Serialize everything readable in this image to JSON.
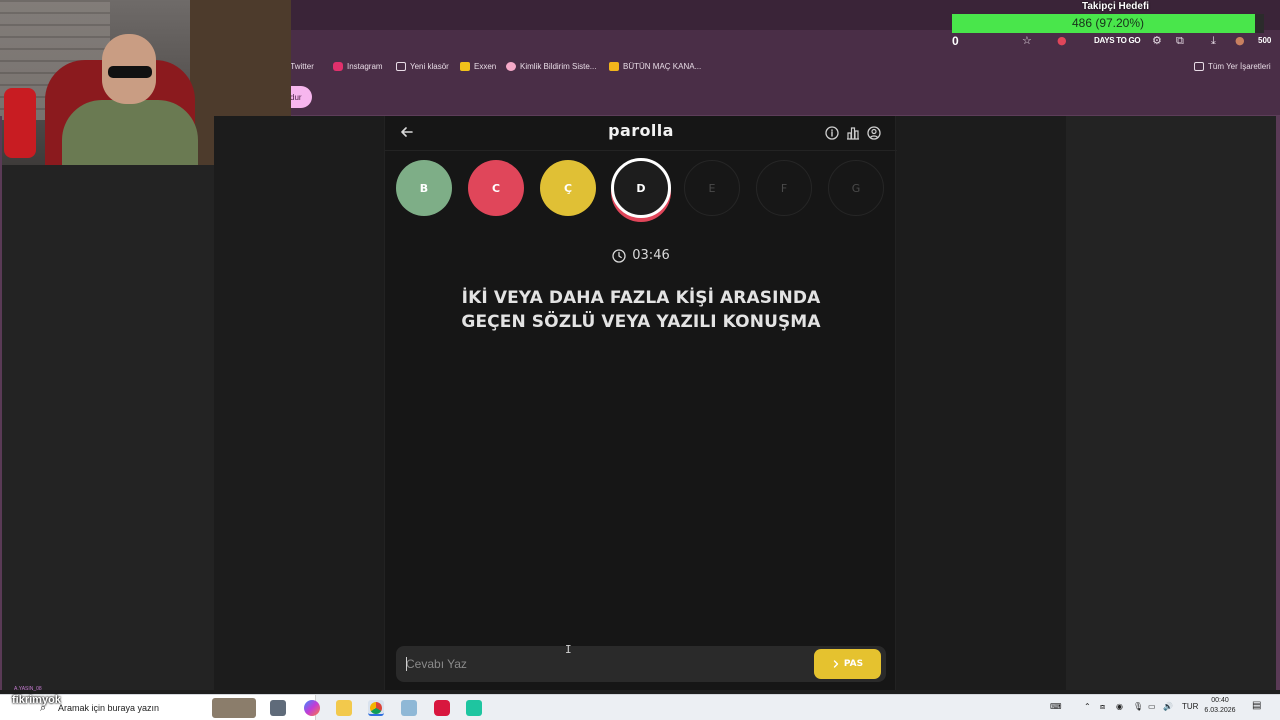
{
  "browser": {
    "bookmarks": [
      {
        "label": "/ Twitter",
        "icon": "twitter-icon"
      },
      {
        "label": "Instagram",
        "icon": "instagram-icon"
      },
      {
        "label": "Yeni klasör",
        "icon": "folder-icon"
      },
      {
        "label": "Exxen",
        "icon": "exxen-icon"
      },
      {
        "label": "Kimlik Bildirim Siste...",
        "icon": "link-icon"
      },
      {
        "label": "BÜTÜN MAÇ KANA...",
        "icon": "jp-icon"
      }
    ],
    "all_bookmarks": "Tüm Yer İşaretleri",
    "pill_text": "dur"
  },
  "stream_overlay": {
    "goal_title": "Takipçi Hedefi",
    "goal_text": "486 (97.20%)",
    "goal_fraction": 0.972,
    "left_counter": "0",
    "days_to_go": "DAYS TO GO",
    "right_counter": "500",
    "watermark": "fikrimyok",
    "tiny_name": "A.YASIN_08"
  },
  "game": {
    "title": "parolla",
    "letters": [
      {
        "letter": "B",
        "state": "correct",
        "color": "#7eae87"
      },
      {
        "letter": "C",
        "state": "wrong",
        "color": "#e0465a"
      },
      {
        "letter": "Ç",
        "state": "passed",
        "color": "#e0c035"
      },
      {
        "letter": "D",
        "state": "current",
        "color": "#1d1d1d"
      },
      {
        "letter": "E",
        "state": "pending",
        "color": "#171717"
      },
      {
        "letter": "F",
        "state": "pending",
        "color": "#171717"
      },
      {
        "letter": "G",
        "state": "pending",
        "color": "#171717"
      }
    ],
    "timer": "03:46",
    "question_line1": "İKİ VEYA DAHA FAZLA KİŞİ ARASINDA",
    "question_line2": "GEÇEN SÖZLÜ VEYA YAZILI KONUŞMA",
    "answer_placeholder": "Cevabı Yaz",
    "pass_label": "PAS"
  },
  "taskbar": {
    "search_placeholder": "Aramak için buraya yazın",
    "language": "TUR",
    "time": "00:40",
    "date": "6.03.2026"
  },
  "colors": {
    "accent_yellow": "#e5c22f",
    "goal_green": "#49e64b",
    "correct": "#7eae87",
    "wrong": "#e0465a"
  }
}
